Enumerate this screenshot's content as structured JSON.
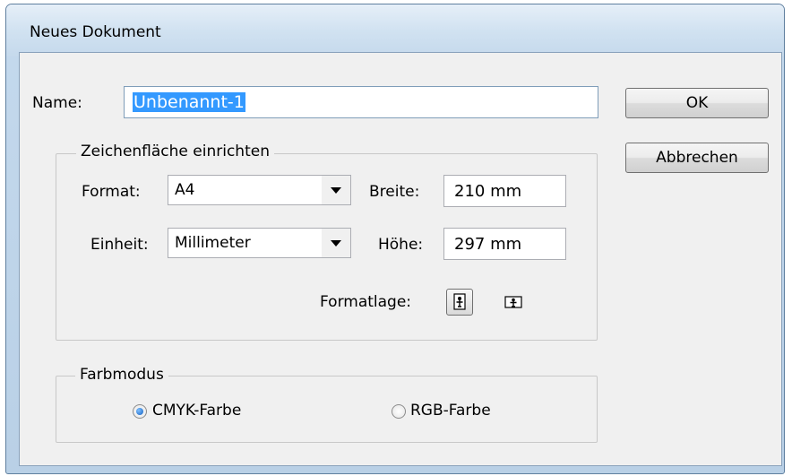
{
  "window": {
    "title": "Neues Dokument"
  },
  "name": {
    "label": "Name:",
    "value": "Unbenannt-1"
  },
  "buttons": {
    "ok": "OK",
    "cancel": "Abbrechen"
  },
  "artboard": {
    "legend": "Zeichenfläche einrichten",
    "format_label": "Format:",
    "format_value": "A4",
    "unit_label": "Einheit:",
    "unit_value": "Millimeter",
    "width_label": "Breite:",
    "width_value": "210 mm",
    "height_label": "Höhe:",
    "height_value": "297 mm",
    "orientation_label": "Formatlage:",
    "orientation_selected": "portrait"
  },
  "color_mode": {
    "legend": "Farbmodus",
    "options": [
      "CMYK-Farbe",
      "RGB-Farbe"
    ],
    "selected": "CMYK-Farbe"
  },
  "icons": [
    "portrait-orientation-icon",
    "landscape-orientation-icon"
  ],
  "colors": {
    "selection": "#3399ff",
    "title_gradient": "#c5d9ec",
    "panel": "#f0f0f0"
  }
}
